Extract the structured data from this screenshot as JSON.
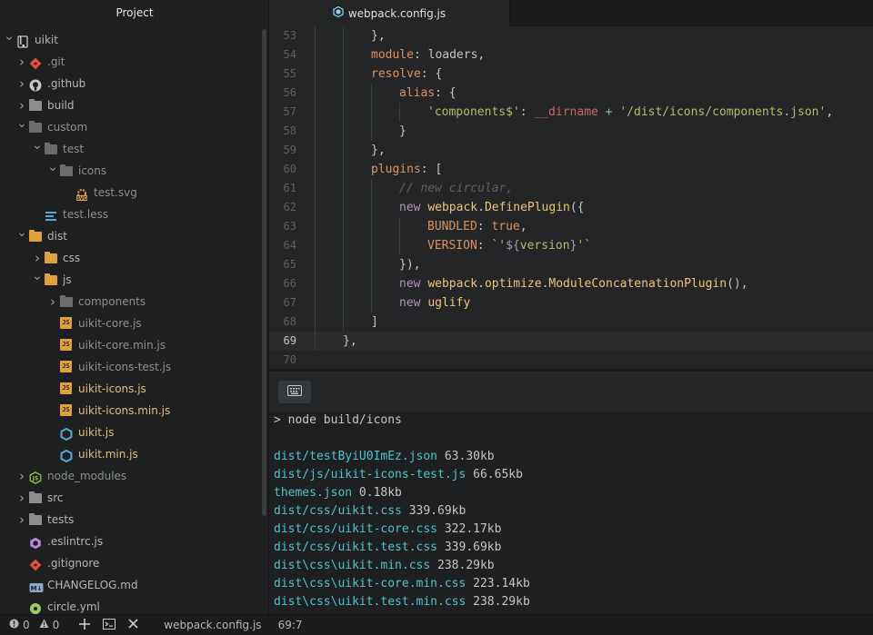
{
  "sidebar": {
    "title": "Project",
    "tree": [
      {
        "label": "uikit",
        "depth": 0,
        "chev": "down",
        "icon": "repo-icon"
      },
      {
        "label": ".git",
        "depth": 1,
        "chev": "right",
        "icon": "git-icon",
        "dim": true
      },
      {
        "label": ".github",
        "depth": 1,
        "chev": "right",
        "icon": "github-icon"
      },
      {
        "label": "build",
        "depth": 1,
        "chev": "right",
        "icon": "folder-icon"
      },
      {
        "label": "custom",
        "depth": 1,
        "chev": "down",
        "icon": "folder-icon",
        "dim": true
      },
      {
        "label": "test",
        "depth": 2,
        "chev": "down",
        "icon": "folder-icon",
        "dim": true
      },
      {
        "label": "icons",
        "depth": 3,
        "chev": "down",
        "icon": "folder-icon",
        "dim": true
      },
      {
        "label": "test.svg",
        "depth": 4,
        "chev": "",
        "icon": "svg-file-icon",
        "dim": true
      },
      {
        "label": "test.less",
        "depth": 2,
        "chev": "",
        "icon": "css-file-icon",
        "dim": true
      },
      {
        "label": "dist",
        "depth": 1,
        "chev": "down",
        "icon": "folder-open-icon"
      },
      {
        "label": "css",
        "depth": 2,
        "chev": "right",
        "icon": "folder-open-icon"
      },
      {
        "label": "js",
        "depth": 2,
        "chev": "down",
        "icon": "folder-open-icon"
      },
      {
        "label": "components",
        "depth": 3,
        "chev": "right",
        "icon": "folder-icon",
        "dim": true
      },
      {
        "label": "uikit-core.js",
        "depth": 3,
        "chev": "",
        "icon": "js-file-icon",
        "dim": true
      },
      {
        "label": "uikit-core.min.js",
        "depth": 3,
        "chev": "",
        "icon": "js-file-icon",
        "dim": true
      },
      {
        "label": "uikit-icons-test.js",
        "depth": 3,
        "chev": "",
        "icon": "js-file-icon",
        "dim": true
      },
      {
        "label": "uikit-icons.js",
        "depth": 3,
        "chev": "",
        "icon": "js-file-icon",
        "hl": true
      },
      {
        "label": "uikit-icons.min.js",
        "depth": 3,
        "chev": "",
        "icon": "js-file-icon",
        "hl": true
      },
      {
        "label": "uikit.js",
        "depth": 3,
        "chev": "",
        "icon": "uikit-file-icon",
        "hl": true
      },
      {
        "label": "uikit.min.js",
        "depth": 3,
        "chev": "",
        "icon": "uikit-file-icon",
        "hl": true
      },
      {
        "label": "node_modules",
        "depth": 1,
        "chev": "right",
        "icon": "node-icon",
        "dim": true
      },
      {
        "label": "src",
        "depth": 1,
        "chev": "right",
        "icon": "folder-icon"
      },
      {
        "label": "tests",
        "depth": 1,
        "chev": "right",
        "icon": "folder-icon"
      },
      {
        "label": ".eslintrc.js",
        "depth": 1,
        "chev": "",
        "icon": "eslint-icon"
      },
      {
        "label": ".gitignore",
        "depth": 1,
        "chev": "",
        "icon": "git-icon"
      },
      {
        "label": "CHANGELOG.md",
        "depth": 1,
        "chev": "",
        "icon": "markdown-icon"
      },
      {
        "label": "circle.yml",
        "depth": 1,
        "chev": "",
        "icon": "circle-icon"
      }
    ]
  },
  "tab": {
    "label": "webpack.config.js"
  },
  "editor": {
    "current_line": "69",
    "lines": [
      {
        "n": "53",
        "indent": 2,
        "tokens": [
          [
            "p",
            "},"
          ]
        ]
      },
      {
        "n": "54",
        "indent": 2,
        "tokens": [
          [
            "k",
            "module"
          ],
          [
            "p",
            ": loaders,"
          ]
        ]
      },
      {
        "n": "55",
        "indent": 2,
        "tokens": [
          [
            "k",
            "resolve"
          ],
          [
            "p",
            ": {"
          ]
        ]
      },
      {
        "n": "56",
        "indent": 3,
        "tokens": [
          [
            "k",
            "alias"
          ],
          [
            "p",
            ": {"
          ]
        ]
      },
      {
        "n": "57",
        "indent": 4,
        "tokens": [
          [
            "s",
            "'components$'"
          ],
          [
            "p",
            ": "
          ],
          [
            "v",
            "__dirname"
          ],
          [
            "o",
            " + "
          ],
          [
            "s",
            "'/dist/icons/components.json'"
          ],
          [
            "p",
            ","
          ]
        ]
      },
      {
        "n": "58",
        "indent": 3,
        "tokens": [
          [
            "p",
            "}"
          ]
        ]
      },
      {
        "n": "59",
        "indent": 2,
        "tokens": [
          [
            "p",
            "},"
          ]
        ]
      },
      {
        "n": "60",
        "indent": 2,
        "tokens": [
          [
            "k",
            "plugins"
          ],
          [
            "p",
            ": ["
          ]
        ]
      },
      {
        "n": "61",
        "indent": 3,
        "tokens": [
          [
            "c",
            "// new circular,"
          ]
        ]
      },
      {
        "n": "62",
        "indent": 3,
        "tokens": [
          [
            "w",
            "new "
          ],
          [
            "f",
            "webpack"
          ],
          [
            "p",
            "."
          ],
          [
            "f",
            "DefinePlugin"
          ],
          [
            "p",
            "({"
          ]
        ]
      },
      {
        "n": "63",
        "indent": 4,
        "tokens": [
          [
            "k",
            "BUNDLED"
          ],
          [
            "p",
            ": "
          ],
          [
            "n",
            "true"
          ],
          [
            "p",
            ","
          ]
        ]
      },
      {
        "n": "64",
        "indent": 4,
        "tokens": [
          [
            "k",
            "VERSION"
          ],
          [
            "p",
            ": "
          ],
          [
            "s",
            "`'"
          ],
          [
            "w",
            "${"
          ],
          [
            "s",
            "version"
          ],
          [
            "w",
            "}"
          ],
          [
            "s",
            "'`"
          ]
        ]
      },
      {
        "n": "65",
        "indent": 3,
        "tokens": [
          [
            "p",
            "}),"
          ]
        ]
      },
      {
        "n": "66",
        "indent": 3,
        "tokens": [
          [
            "w",
            "new "
          ],
          [
            "f",
            "webpack"
          ],
          [
            "p",
            "."
          ],
          [
            "f",
            "optimize"
          ],
          [
            "p",
            "."
          ],
          [
            "f",
            "ModuleConcatenationPlugin"
          ],
          [
            "p",
            "(),"
          ]
        ]
      },
      {
        "n": "67",
        "indent": 3,
        "tokens": [
          [
            "w",
            "new "
          ],
          [
            "f",
            "uglify"
          ]
        ]
      },
      {
        "n": "68",
        "indent": 2,
        "tokens": [
          [
            "p",
            "]"
          ]
        ]
      },
      {
        "n": "69",
        "indent": 1,
        "tokens": [
          [
            "p",
            "},"
          ]
        ]
      },
      {
        "n": "70",
        "indent": 0,
        "tokens": []
      }
    ]
  },
  "terminal": {
    "prompt": "> node build/icons",
    "output": [
      {
        "file": "dist/testByiU0ImEz.json",
        "size": " 63.30kb"
      },
      {
        "file": "dist/js/uikit-icons-test.js",
        "size": " 66.65kb"
      },
      {
        "file": "themes.json",
        "size": " 0.18kb"
      },
      {
        "file": "dist/css/uikit.css",
        "size": " 339.69kb"
      },
      {
        "file": "dist/css/uikit-core.css",
        "size": " 322.17kb"
      },
      {
        "file": "dist/css/uikit.test.css",
        "size": " 339.69kb"
      },
      {
        "file": "dist\\css\\uikit.min.css",
        "size": " 238.29kb"
      },
      {
        "file": "dist\\css\\uikit-core.min.css",
        "size": " 223.14kb"
      },
      {
        "file": "dist\\css\\uikit.test.min.css",
        "size": " 238.29kb"
      }
    ]
  },
  "status": {
    "errors": "0",
    "warnings": "0",
    "file": "webpack.config.js",
    "cursor": "69:7"
  }
}
